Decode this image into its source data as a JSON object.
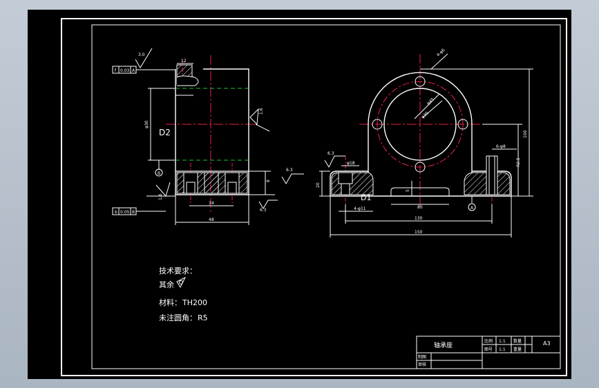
{
  "drawing": {
    "colors": {
      "background": "#000000",
      "outline": "#ffffff",
      "centerline": "#e6204a",
      "hidden": "#1fbf3a",
      "dimension": "#ffffff"
    },
    "left_view": {
      "tolerance_top": {
        "symbol": "f",
        "value": "0.03",
        "datum": "A"
      },
      "tolerance_bottom": {
        "symbol": "b",
        "value": "0.05",
        "datum": "B"
      },
      "surface_marks": [
        "3.0",
        "1.6",
        "6.3",
        "1.6",
        "6.3"
      ],
      "dims": {
        "top": "12",
        "bore": "φ30",
        "bottom_inner": "34",
        "bottom_outer": "48",
        "step": "8"
      },
      "label": "D2",
      "datum_b": "B"
    },
    "front_view": {
      "hole_callout": "4-φ6",
      "bolt_circle": "φ45",
      "bore": "φ30",
      "bolt_holes": "φ11",
      "counterbore": "φ18",
      "right_detail": [
        "6-φ8",
        "R2.5"
      ],
      "surface_mark": "6.3",
      "label": "D1",
      "datum_a": "A",
      "dims": {
        "height": "100",
        "base_h": "20",
        "slot_h": "5",
        "slot_w": "80",
        "mid_w": "130",
        "total_w": "150",
        "left_hole": "4-φ11"
      }
    },
    "notes": {
      "title": "技术要求：",
      "line1": "其余",
      "line2_label": "材料：",
      "line2_value": "TH200",
      "line3_label": "未注圆角：",
      "line3_value": "R5"
    },
    "title_block": {
      "name": "轴承座",
      "r1c1": "比例",
      "r1c2": "1:1",
      "r1c3": "数量",
      "r2c1": "图号",
      "r2c2": "1:1",
      "r2c3": "重量",
      "sheet": "A3",
      "drawn": "制图",
      "checked": "审核"
    }
  }
}
